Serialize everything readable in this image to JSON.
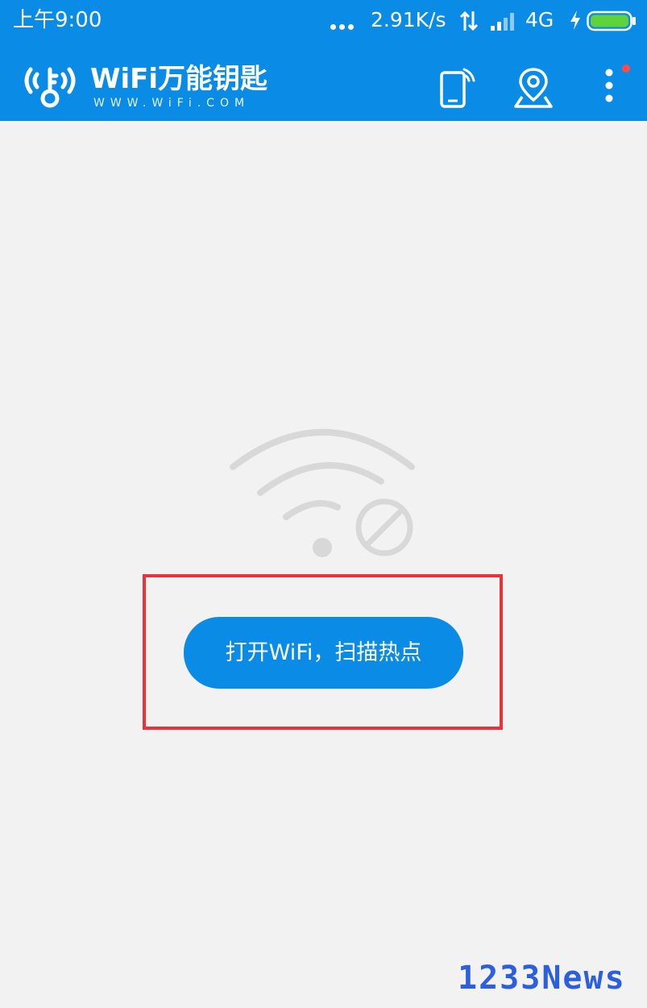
{
  "status_bar": {
    "time": "上午9:00",
    "net_speed": "2.91K/s",
    "network": "4G",
    "icons": [
      "more-dots-icon",
      "data-arrows-icon",
      "signal-icon",
      "charging-icon",
      "battery-icon"
    ]
  },
  "app_bar": {
    "title": "WiFi万能钥匙",
    "subtitle": "WWW.WiFi.COM",
    "icons": [
      "wifi-key-logo-icon",
      "phone-wifi-icon",
      "location-pin-icon",
      "more-vertical-icon"
    ],
    "has_notification_dot": true
  },
  "main": {
    "empty_state_icon": "wifi-disabled-icon",
    "open_wifi_button": "打开WiFi，扫描热点"
  },
  "watermark": "1233News",
  "colors": {
    "brand_blue": "#0a8be6",
    "background": "#f2f2f2",
    "highlight_red": "#e8333a",
    "notification_red": "#ff4a4a",
    "icon_gray": "#d8d8d8",
    "watermark_blue": "#2b5fe0"
  }
}
